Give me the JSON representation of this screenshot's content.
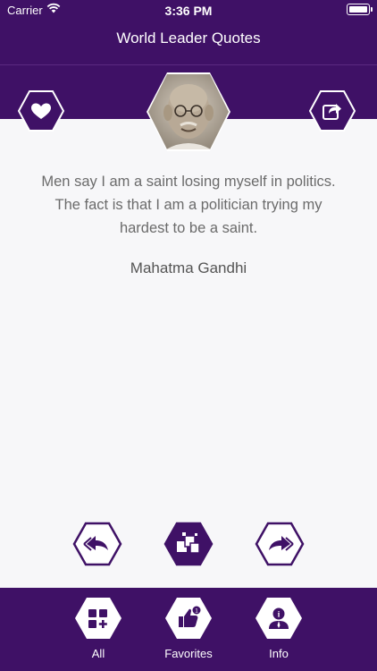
{
  "status_bar": {
    "carrier": "Carrier",
    "time": "3:36 PM"
  },
  "header": {
    "title": "World Leader Quotes"
  },
  "quote": {
    "text": "Men say I am a saint losing myself in politics. The fact is that I am a politician trying my hardest to be a saint.",
    "author": "Mahatma Gandhi"
  },
  "icons": {
    "favorite": "heart-icon",
    "share": "share-icon",
    "previous": "previous-arrow-icon",
    "random": "random-cards-icon",
    "next": "next-arrow-icon"
  },
  "tabs": [
    {
      "label": "All",
      "icon": "grid-add-icon"
    },
    {
      "label": "Favorites",
      "icon": "thumbs-up-icon"
    },
    {
      "label": "Info",
      "icon": "info-person-icon"
    }
  ],
  "colors": {
    "primary": "#3f1166",
    "background": "#f7f7f9",
    "text": "#6b6b6b"
  }
}
